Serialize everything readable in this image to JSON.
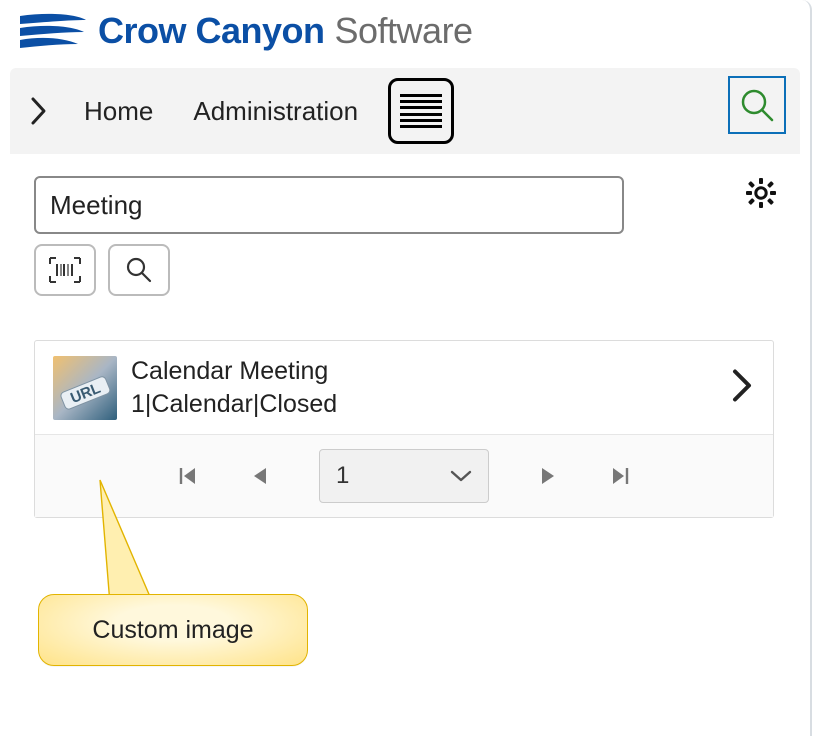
{
  "brand": {
    "name_primary": "Crow Canyon",
    "name_secondary": "Software"
  },
  "topnav": {
    "items": [
      {
        "label": "Home"
      },
      {
        "label": "Administration"
      }
    ]
  },
  "search": {
    "value": "Meeting",
    "placeholder": ""
  },
  "results": {
    "items": [
      {
        "title": "Calendar Meeting",
        "subtitle": "1|Calendar|Closed"
      }
    ]
  },
  "pager": {
    "current_page": "1"
  },
  "callout": {
    "label": "Custom image"
  },
  "colors": {
    "brand_primary": "#0b4fa5",
    "accent_search": "#2e8b2e"
  }
}
